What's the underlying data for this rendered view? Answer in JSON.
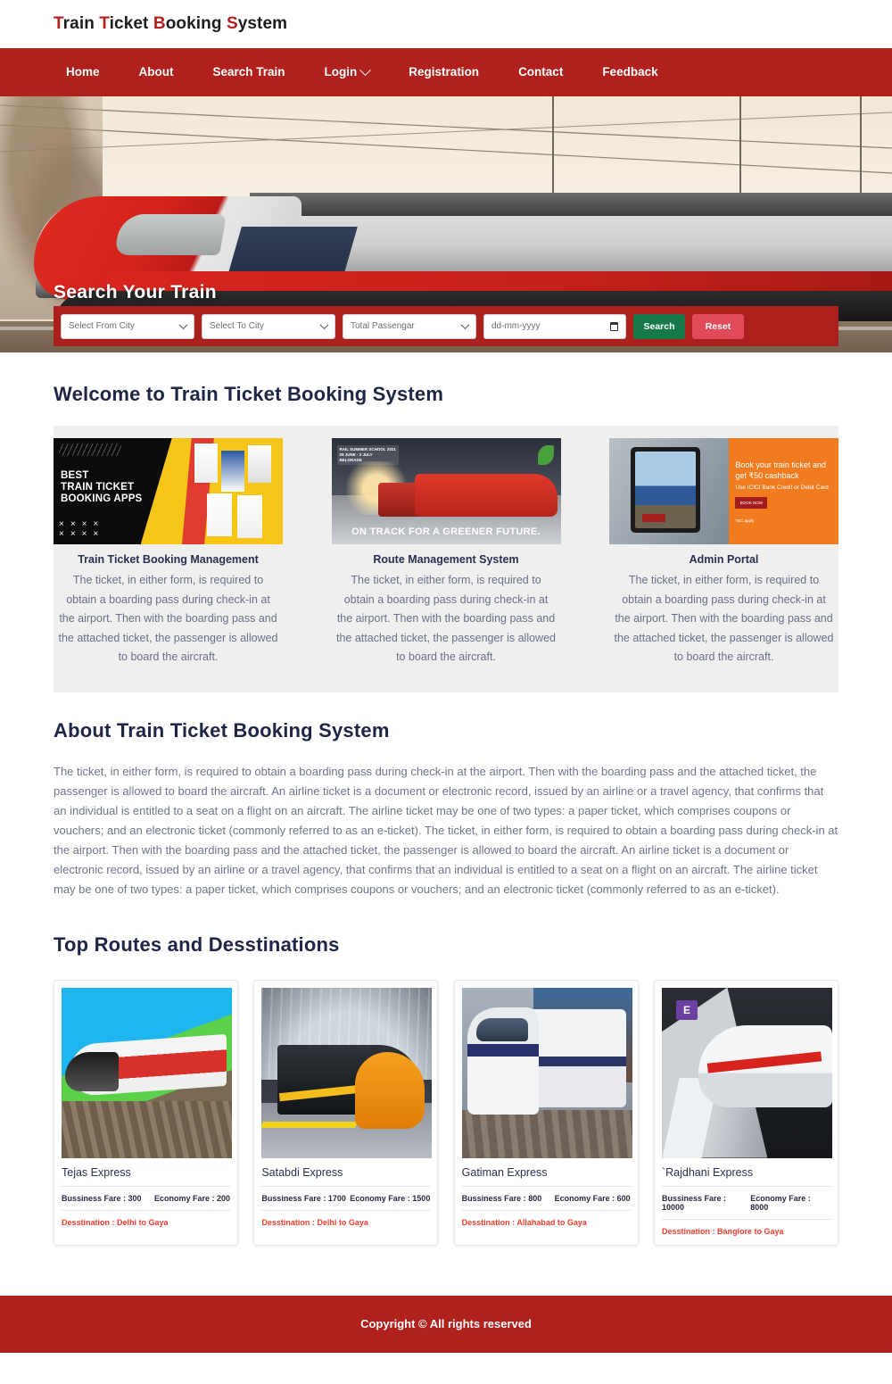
{
  "brand": {
    "title_parts": [
      {
        "t": "T",
        "hl": true
      },
      {
        "t": "rain ",
        "hl": false
      },
      {
        "t": "T",
        "hl": true
      },
      {
        "t": "icket ",
        "hl": false
      },
      {
        "t": "B",
        "hl": true
      },
      {
        "t": "ooking ",
        "hl": false
      },
      {
        "t": "S",
        "hl": true
      },
      {
        "t": "ystem",
        "hl": false
      }
    ],
    "title_plain": "Train Ticket Booking System"
  },
  "nav": {
    "items": [
      {
        "label": "Home",
        "has_caret": false
      },
      {
        "label": "About",
        "has_caret": false
      },
      {
        "label": "Search Train",
        "has_caret": false
      },
      {
        "label": "Login",
        "has_caret": true
      },
      {
        "label": "Registration",
        "has_caret": false
      },
      {
        "label": "Contact",
        "has_caret": false
      },
      {
        "label": "Feedback",
        "has_caret": false
      }
    ]
  },
  "hero": {
    "heading": "Search Your Train",
    "from_city": "Select From City",
    "to_city": "Select To City",
    "passengers": "Total Passengar",
    "date_placeholder": "dd-mm-yyyy",
    "search_label": "Search",
    "reset_label": "Reset"
  },
  "welcome": {
    "title": "Welcome to Train Ticket Booking System",
    "cards": [
      {
        "caption": "Train Ticket Booking Management",
        "image_alt": "BEST TRAIN TICKET BOOKING APPS",
        "image_text": "BEST\nTRAIN TICKET\nBOOKING APPS",
        "text": "The ticket, in either form, is required to obtain a boarding pass during check-in at the airport. Then with the boarding pass and the attached ticket, the passenger is allowed to board the aircraft."
      },
      {
        "caption": "Route Management System",
        "image_alt": "ON TRACK FOR A GREENER FUTURE.",
        "image_text": "ON TRACK FOR A GREENER FUTURE.",
        "image_tag": "RAIL SUMMER SCHOOL 2021\n29 JUNE - 2 JULY\nBELGRADE",
        "text": "The ticket, in either form, is required to obtain a boarding pass during check-in at the airport. Then with the boarding pass and the attached ticket, the passenger is allowed to board the aircraft."
      },
      {
        "caption": "Admin Portal",
        "image_alt": "Book your train ticket and get Rs.50 cashback",
        "image_text": "Book your train ticket and get ₹50 cashback",
        "image_sub": "Use ICICI Bank Credit or Debit Card",
        "image_button": "BOOK NOW",
        "image_tc": "T&C apply",
        "text": "The ticket, in either form, is required to obtain a boarding pass during check-in at the airport. Then with the boarding pass and the attached ticket, the passenger is allowed to board the aircraft."
      }
    ]
  },
  "about": {
    "title": "About Train Ticket Booking System",
    "paragraph": "The ticket, in either form, is required to obtain a boarding pass during check-in at the airport. Then with the boarding pass and the attached ticket, the passenger is allowed to board the aircraft. An airline ticket is a document or electronic record, issued by an airline or a travel agency, that confirms that an individual is entitled to a seat on a flight on an aircraft. The airline ticket may be one of two types: a paper ticket, which comprises coupons or vouchers; and an electronic ticket (commonly referred to as an e-ticket). The ticket, in either form, is required to obtain a boarding pass during check-in at the airport. Then with the boarding pass and the attached ticket, the passenger is allowed to board the aircraft. An airline ticket is a document or electronic record, issued by an airline or a travel agency, that confirms that an individual is entitled to a seat on a flight on an aircraft. The airline ticket may be one of two types: a paper ticket, which comprises coupons or vouchers; and an electronic ticket (commonly referred to as an e-ticket)."
  },
  "routes": {
    "title": "Top Routes and Desstinations",
    "cards": [
      {
        "name": "Tejas Express",
        "business_fare": "Bussiness Fare : 300",
        "economy_fare": "Economy Fare : 200",
        "destination": "Desstination : Delhi to Gaya",
        "image_alt": "Red and white Tejas Express speeding on track"
      },
      {
        "name": "Satabdi Express",
        "business_fare": "Bussiness Fare : 1700",
        "economy_fare": "Economy Fare : 1500",
        "destination": "Desstination : Delhi to Gaya",
        "image_alt": "Orange nosed express train at a vaulted station"
      },
      {
        "name": "Gatiman Express",
        "business_fare": "Bussiness Fare : 800",
        "economy_fare": "Economy Fare : 600",
        "destination": "Desstination : Allahabad to Gaya",
        "image_alt": "Blue and white Gatiman Express at platform"
      },
      {
        "name": "`Rajdhani Express",
        "business_fare": "Bussiness Fare : 10000",
        "economy_fare": "Economy Fare : 8000",
        "destination": "Desstination : Banglore to Gaya",
        "image_alt": "White high speed train with red stripe at station"
      }
    ]
  },
  "footer": {
    "copyright": "Copyright © All rights reserved"
  },
  "colors": {
    "brand_red": "#b0201d",
    "panel_red": "#ab1f1c",
    "accent_red_text": "#b51f1f",
    "search_green": "#15794a",
    "reset_pink": "#e04a59",
    "heading_navy": "#1f2545",
    "body_grey": "#6f7689",
    "dest_red": "#f43c2e",
    "strip_grey": "#efefef"
  }
}
